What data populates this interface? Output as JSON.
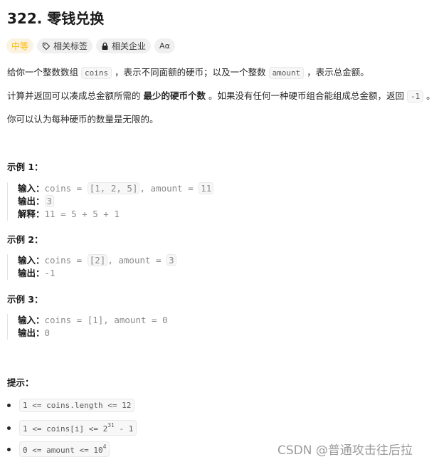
{
  "title": "322. 零钱兑换",
  "badges": {
    "difficulty": "中等",
    "tags": "相关标签",
    "companies": "相关企业",
    "translate": "Aα"
  },
  "description": {
    "p1": {
      "a": "给你一个整数数组 ",
      "code1": "coins",
      "b": " ，表示不同面额的硬币；以及一个整数 ",
      "code2": "amount",
      "c": " ，表示总金额。"
    },
    "p2": {
      "a": "计算并返回可以凑成总金额所需的 ",
      "bold": "最少的硬币个数",
      "b": " 。如果没有任何一种硬币组合能组成总金额，返回 ",
      "code": "-1",
      "c": " 。"
    },
    "p3": "你可以认为每种硬币的数量是无限的。"
  },
  "examples": [
    {
      "heading": "示例 1：",
      "input_label": "输入：",
      "input_a": "coins = ",
      "input_coins": "[1, 2, 5]",
      "input_b": ", amount = ",
      "input_amount": "11",
      "output_label": "输出：",
      "output": "3",
      "explain_label": "解释：",
      "explain": "11 = 5 + 5 + 1"
    },
    {
      "heading": "示例 2：",
      "input_label": "输入：",
      "input_a": "coins = ",
      "input_coins": "[2]",
      "input_b": ", amount = ",
      "input_amount": "3",
      "output_label": "输出：",
      "output": "-1"
    },
    {
      "heading": "示例 3：",
      "input_label": "输入：",
      "input": "coins = [1], amount = 0",
      "output_label": "输出：",
      "output": "0"
    }
  ],
  "constraints": {
    "heading": "提示：",
    "items": [
      {
        "text": "1 <= coins.length <= 12"
      },
      {
        "pre": "1 <= coins[i] <= 2",
        "sup": "31",
        "post": " - 1"
      },
      {
        "pre": "0 <= amount <= 10",
        "sup": "4",
        "post": ""
      }
    ]
  },
  "watermark": "CSDN @普通攻击往后拉"
}
